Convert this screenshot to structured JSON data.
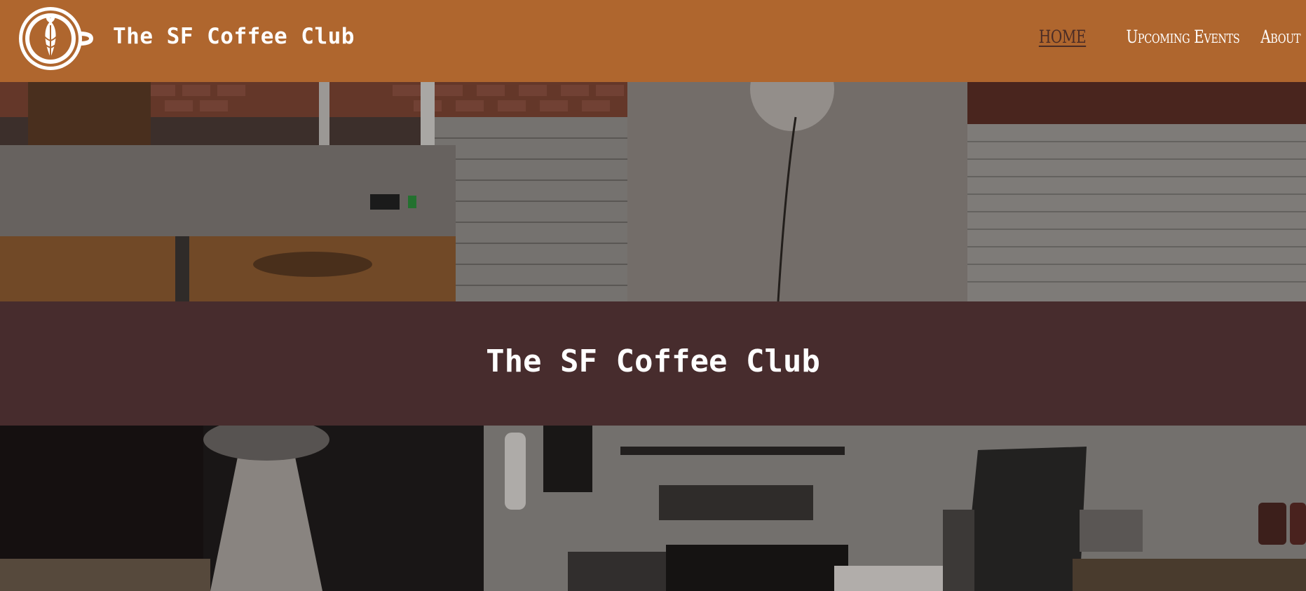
{
  "header": {
    "brand": "The SF Coffee Club",
    "logo_icon": "latte-art-cup-icon"
  },
  "nav": {
    "items": [
      {
        "label": "HOME",
        "active": true
      },
      {
        "label": "Upcoming Events",
        "active": false
      },
      {
        "label": "About",
        "active": false
      }
    ]
  },
  "hero": {
    "title": "The SF Coffee Club",
    "image_top": "coffee-shop-counter-photo",
    "image_bottom": "coffee-bar-equipment-photo"
  },
  "colors": {
    "header_bg": "#af662e",
    "band_bg": "#472c2d",
    "active_nav": "#4a2c26"
  }
}
